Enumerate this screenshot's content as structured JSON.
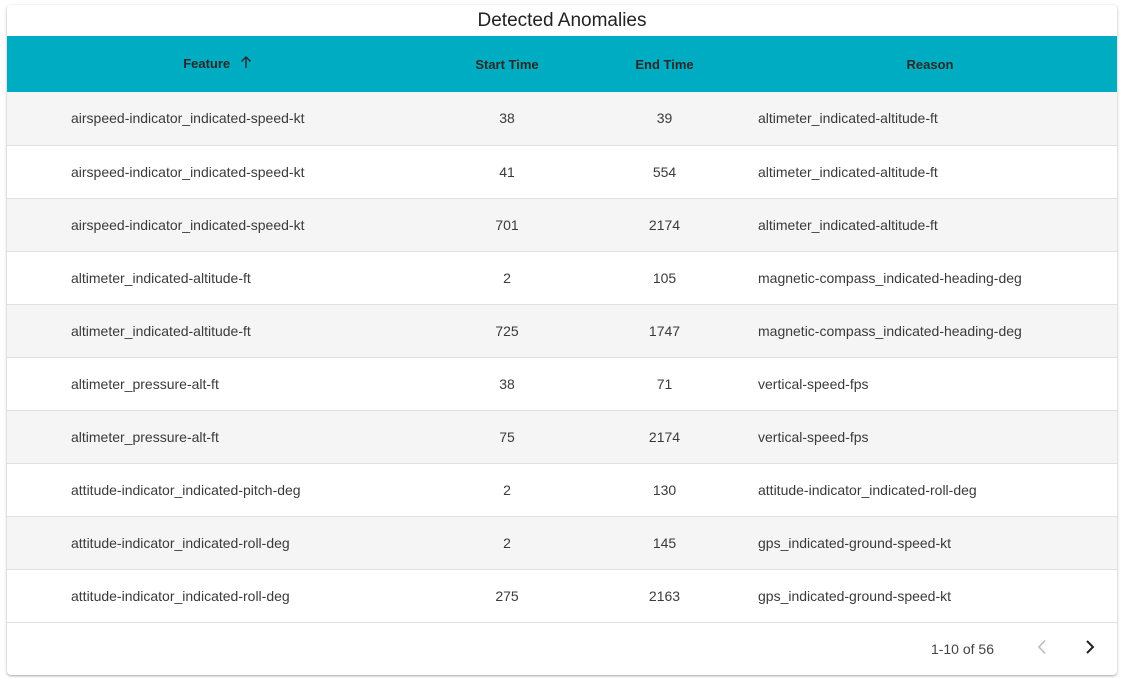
{
  "title": "Detected Anomalies",
  "columns": {
    "feature": "Feature",
    "start_time": "Start Time",
    "end_time": "End Time",
    "reason": "Reason"
  },
  "sort": {
    "column": "feature",
    "direction": "ascending",
    "icon": "arrow-up-icon"
  },
  "rows": [
    {
      "feature": "airspeed-indicator_indicated-speed-kt",
      "start": "38",
      "end": "39",
      "reason": "altimeter_indicated-altitude-ft"
    },
    {
      "feature": "airspeed-indicator_indicated-speed-kt",
      "start": "41",
      "end": "554",
      "reason": "altimeter_indicated-altitude-ft"
    },
    {
      "feature": "airspeed-indicator_indicated-speed-kt",
      "start": "701",
      "end": "2174",
      "reason": "altimeter_indicated-altitude-ft"
    },
    {
      "feature": "altimeter_indicated-altitude-ft",
      "start": "2",
      "end": "105",
      "reason": "magnetic-compass_indicated-heading-deg"
    },
    {
      "feature": "altimeter_indicated-altitude-ft",
      "start": "725",
      "end": "1747",
      "reason": "magnetic-compass_indicated-heading-deg"
    },
    {
      "feature": "altimeter_pressure-alt-ft",
      "start": "38",
      "end": "71",
      "reason": "vertical-speed-fps"
    },
    {
      "feature": "altimeter_pressure-alt-ft",
      "start": "75",
      "end": "2174",
      "reason": "vertical-speed-fps"
    },
    {
      "feature": "attitude-indicator_indicated-pitch-deg",
      "start": "2",
      "end": "130",
      "reason": "attitude-indicator_indicated-roll-deg"
    },
    {
      "feature": "attitude-indicator_indicated-roll-deg",
      "start": "2",
      "end": "145",
      "reason": "gps_indicated-ground-speed-kt"
    },
    {
      "feature": "attitude-indicator_indicated-roll-deg",
      "start": "275",
      "end": "2163",
      "reason": "gps_indicated-ground-speed-kt"
    }
  ],
  "pagination": {
    "range_label": "1-10 of 56",
    "prev_icon": "chevron-left-icon",
    "next_icon": "chevron-right-icon",
    "prev_enabled": false,
    "next_enabled": true
  },
  "colors": {
    "header_bg": "#00acc1",
    "row_alt_bg": "#f5f5f5",
    "disabled_icon": "#bdbdbd",
    "active_icon": "#222222"
  }
}
